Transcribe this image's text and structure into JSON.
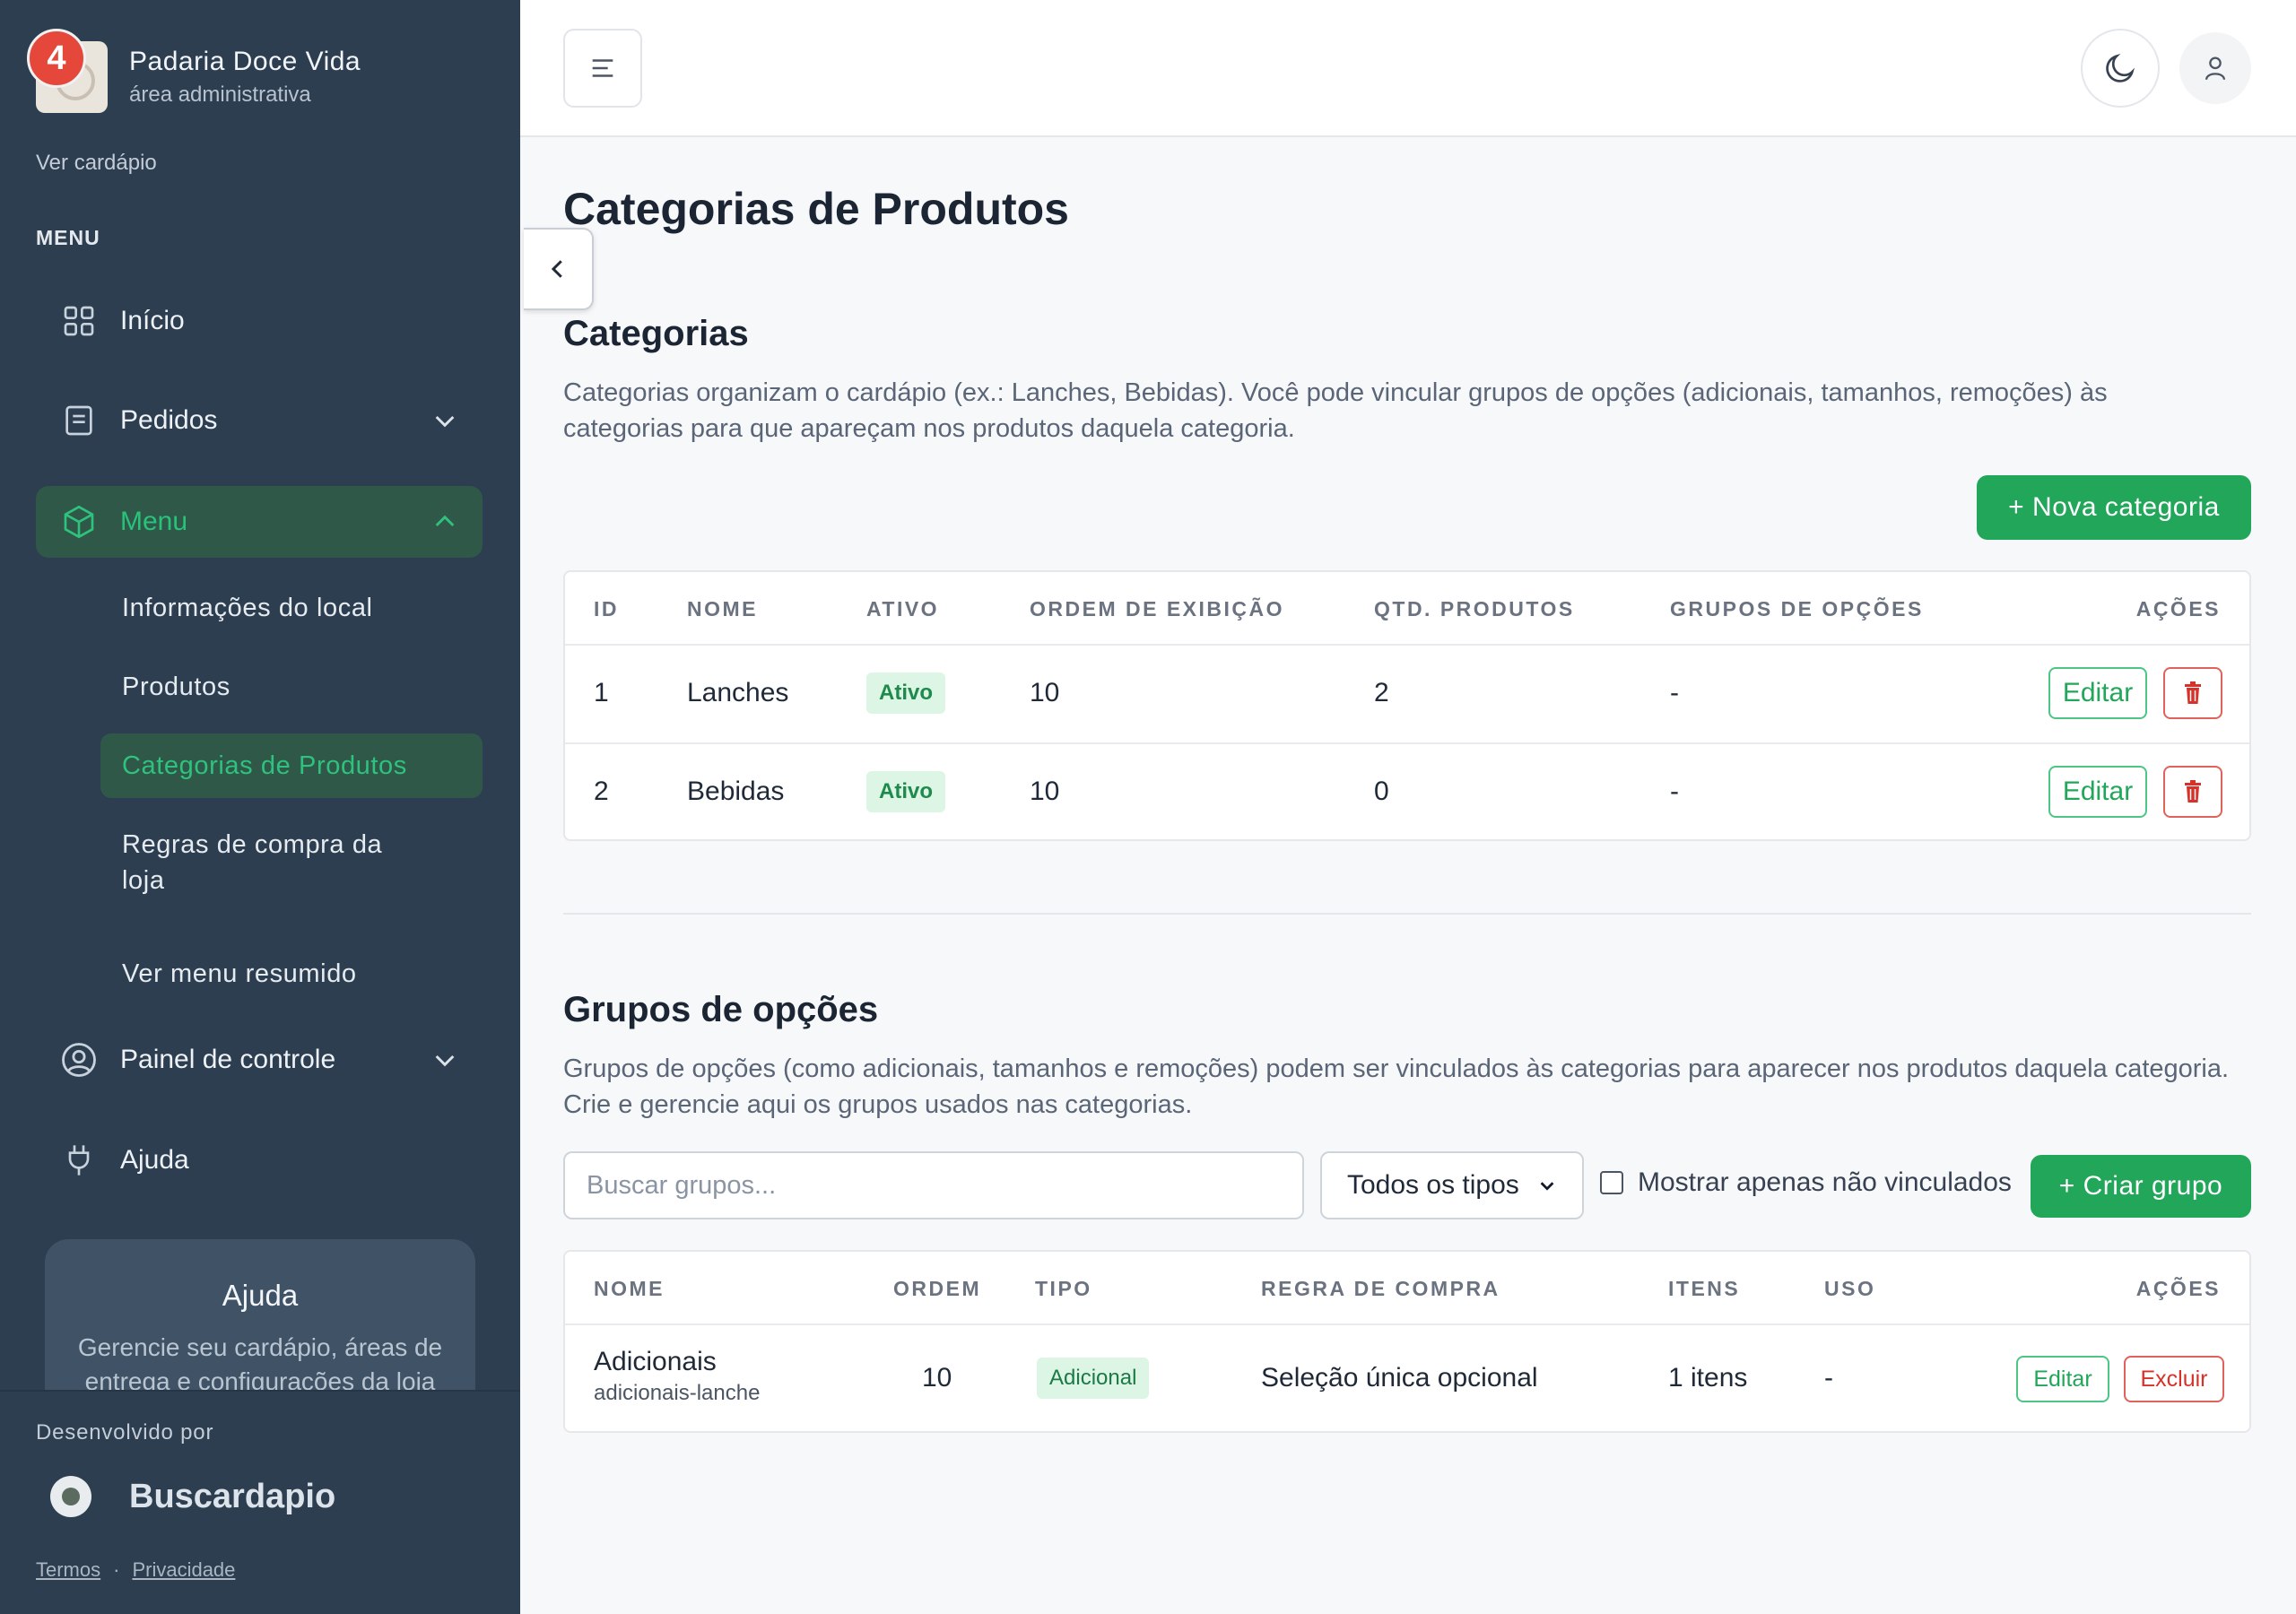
{
  "brand": {
    "name": "Padaria Doce Vida",
    "subtitle": "área administrativa",
    "notifications": "4"
  },
  "sidebar": {
    "view_menu_link": "Ver cardápio",
    "menu_heading": "MENU",
    "items": [
      {
        "label": "Início",
        "icon": "grid-icon"
      },
      {
        "label": "Pedidos",
        "icon": "orders-icon"
      },
      {
        "label": "Menu",
        "icon": "box-icon"
      },
      {
        "label": "Painel de controle",
        "icon": "user-circle-icon"
      },
      {
        "label": "Ajuda",
        "icon": "plug-icon"
      }
    ],
    "sub_items": [
      {
        "label": "Informações do local"
      },
      {
        "label": "Produtos"
      },
      {
        "label": "Categorias de Produtos"
      },
      {
        "label": "Regras de compra da loja"
      },
      {
        "label": "Ver menu resumido"
      }
    ],
    "help_card": {
      "title": "Ajuda",
      "text": "Gerencie seu cardápio, áreas de entrega e configurações da loja"
    },
    "developed_by": "Desenvolvido por",
    "dev_brand": "Buscardapio",
    "terms": "Termos",
    "privacy": "Privacidade"
  },
  "page": {
    "title": "Categorias de Produtos"
  },
  "categories": {
    "title": "Categorias",
    "description": "Categorias organizam o cardápio (ex.: Lanches, Bebidas). Você pode vincular grupos de opções (adicionais, tamanhos, remoções) às categorias para que apareçam nos produtos daquela categoria.",
    "new_button": "+ Nova categoria",
    "columns": [
      "ID",
      "NOME",
      "ATIVO",
      "ORDEM DE EXIBIÇÃO",
      "QTD. PRODUTOS",
      "GRUPOS DE OPÇÕES",
      "AÇÕES"
    ],
    "rows": [
      {
        "id": "1",
        "name": "Lanches",
        "active": "Ativo",
        "order": "10",
        "products": "2",
        "groups": "-"
      },
      {
        "id": "2",
        "name": "Bebidas",
        "active": "Ativo",
        "order": "10",
        "products": "0",
        "groups": "-"
      }
    ],
    "edit_label": "Editar"
  },
  "option_groups": {
    "title": "Grupos de opções",
    "description": "Grupos de opções (como adicionais, tamanhos e remoções) podem ser vinculados às categorias para aparecer nos produtos daquela categoria. Crie e gerencie aqui os grupos usados nas categorias.",
    "search_placeholder": "Buscar grupos...",
    "type_filter": "Todos os tipos",
    "unlinked_only": "Mostrar apenas não vinculados",
    "create_button": "+ Criar grupo",
    "columns": [
      "NOME",
      "ORDEM",
      "TIPO",
      "REGRA DE COMPRA",
      "ITENS",
      "USO",
      "AÇÕES"
    ],
    "rows": [
      {
        "name": "Adicionais",
        "slug": "adicionais-lanche",
        "order": "10",
        "type": "Adicional",
        "rule": "Seleção única opcional",
        "items": "1 itens",
        "usage": "-"
      }
    ],
    "edit_label": "Editar",
    "delete_label": "Excluir"
  },
  "colors": {
    "sidebar_bg": "#2c3e50",
    "accent_green": "#21a65a",
    "danger_red": "#d7322a"
  }
}
